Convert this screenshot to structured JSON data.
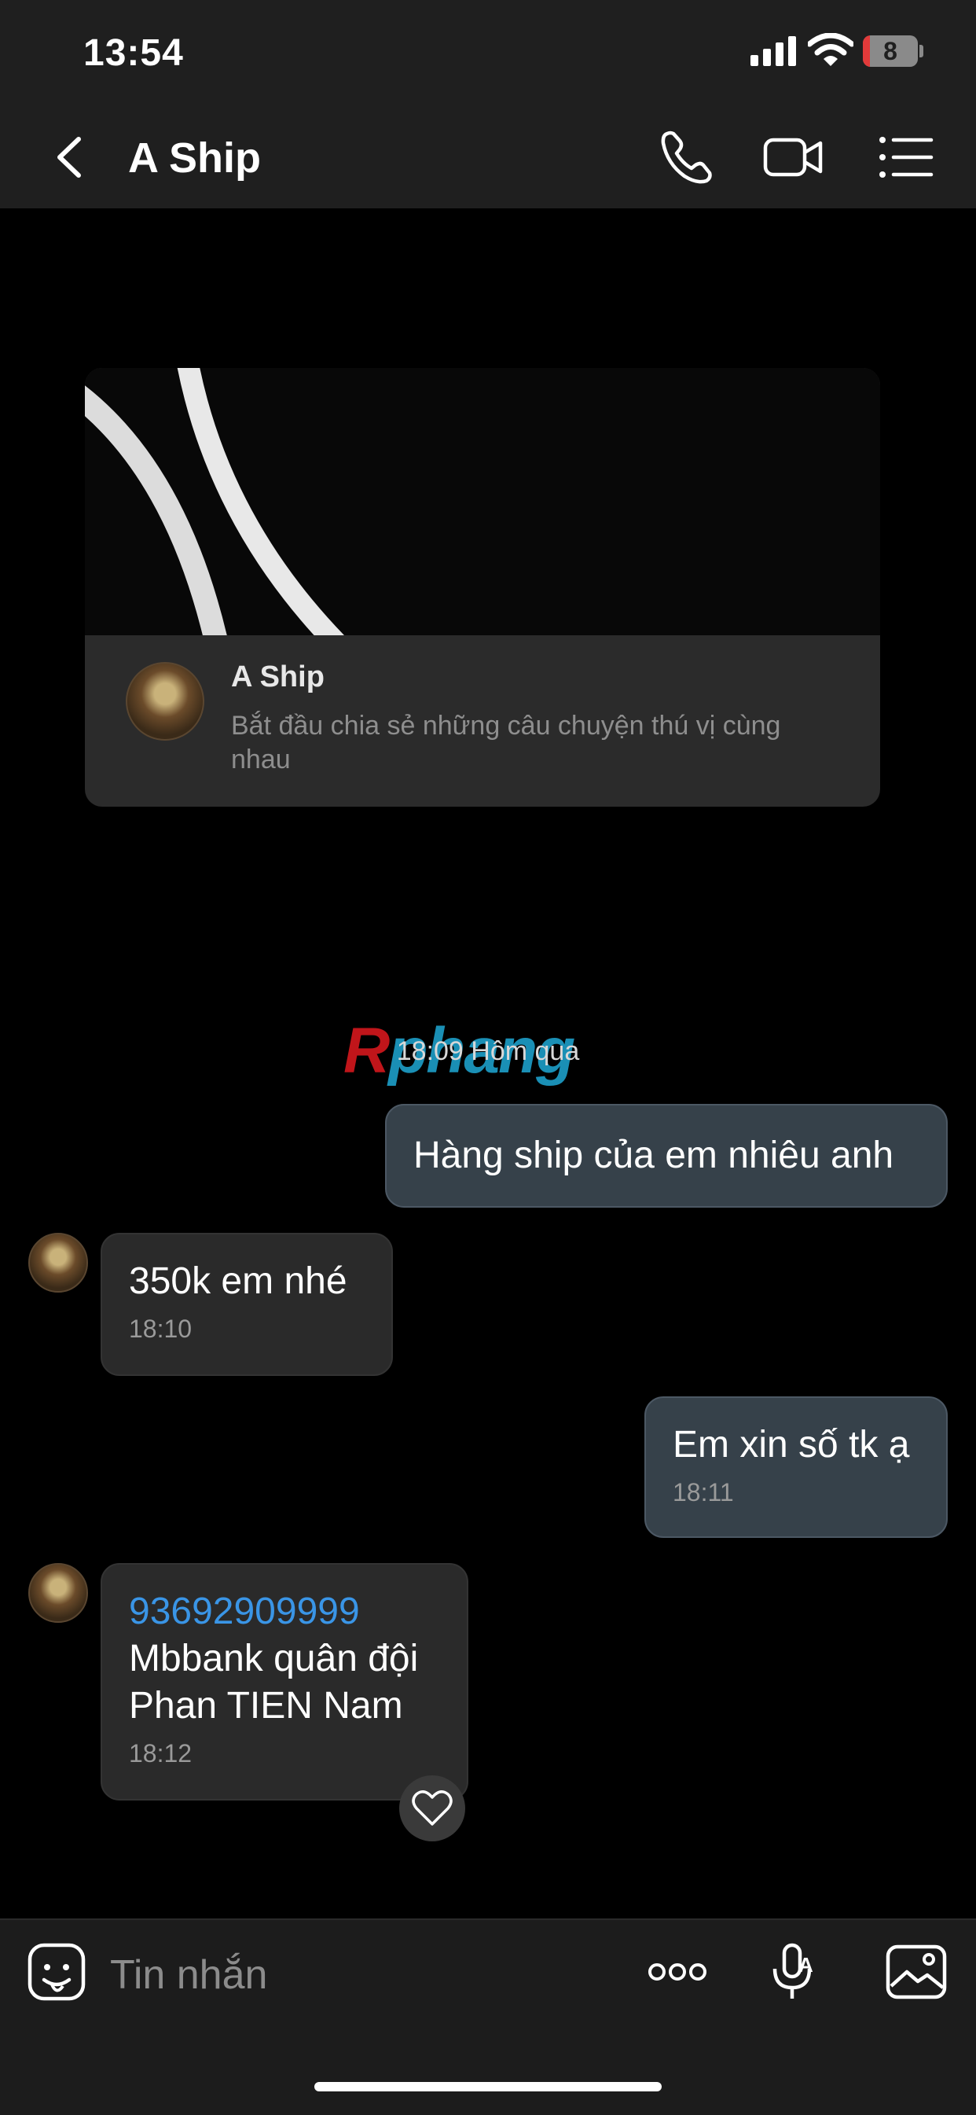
{
  "status": {
    "time": "13:54",
    "battery": "8"
  },
  "header": {
    "title": "A Ship"
  },
  "card": {
    "name": "A Ship",
    "subtitle": "Bắt đầu chia sẻ những câu chuyện thú vị cùng nhau"
  },
  "watermark": {
    "part1": "R",
    "part2": "phang"
  },
  "divider": {
    "date": "18:09 Hôm qua"
  },
  "messages": [
    {
      "text": "Hàng ship của em nhiêu anh"
    },
    {
      "text": "350k em nhé",
      "time": "18:10"
    },
    {
      "text": "Em xin số tk ạ",
      "time": "18:11"
    },
    {
      "link": "93692909999",
      "line2": "Mbbank quân đội",
      "line3": "Phan TIEN Nam",
      "time": "18:12"
    }
  ],
  "input": {
    "placeholder": "Tin nhắn"
  }
}
